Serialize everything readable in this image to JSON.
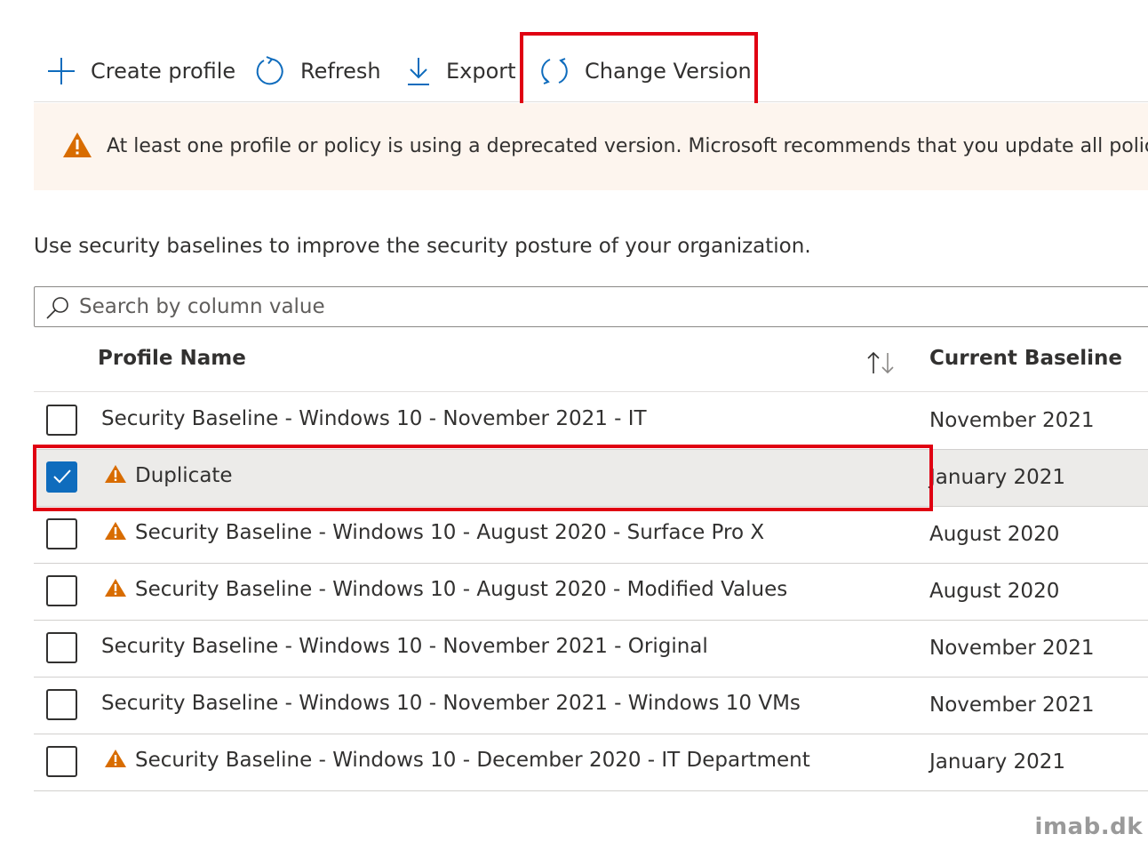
{
  "toolbar": {
    "create_label": "Create profile",
    "refresh_label": "Refresh",
    "export_label": "Export",
    "change_version_label": "Change Version"
  },
  "banner": {
    "icon": "warning-icon",
    "text": "At least one profile or policy is using a deprecated version. Microsoft recommends that you update all policies a"
  },
  "description": "Use security baselines to improve the security posture of your organization.",
  "search": {
    "placeholder": "Search by column value",
    "value": ""
  },
  "table": {
    "columns": [
      "Profile Name",
      "Current Baseline"
    ],
    "rows": [
      {
        "name": "Security Baseline - Windows 10 - November 2021 - IT",
        "baseline": "November 2021",
        "warning": false,
        "checked": false
      },
      {
        "name": "Duplicate",
        "baseline": "January 2021",
        "warning": true,
        "checked": true
      },
      {
        "name": "Security Baseline - Windows 10 - August 2020 - Surface Pro X",
        "baseline": "August 2020",
        "warning": true,
        "checked": false
      },
      {
        "name": "Security Baseline - Windows 10 - August 2020 - Modified Values",
        "baseline": "August 2020",
        "warning": true,
        "checked": false
      },
      {
        "name": "Security Baseline - Windows 10 - November 2021 - Original",
        "baseline": "November 2021",
        "warning": false,
        "checked": false
      },
      {
        "name": "Security Baseline - Windows 10 - November 2021 - Windows 10 VMs",
        "baseline": "November 2021",
        "warning": false,
        "checked": false
      },
      {
        "name": "Security Baseline - Windows 10 - December 2020 - IT Department",
        "baseline": "January 2021",
        "warning": true,
        "checked": false
      }
    ]
  },
  "watermark": "imab.dk",
  "colors": {
    "accent": "#0f6cbd",
    "warning": "#d86c00",
    "highlight": "#e00012",
    "banner_bg": "#fdf5ee",
    "selected_row": "#ecebe9"
  }
}
